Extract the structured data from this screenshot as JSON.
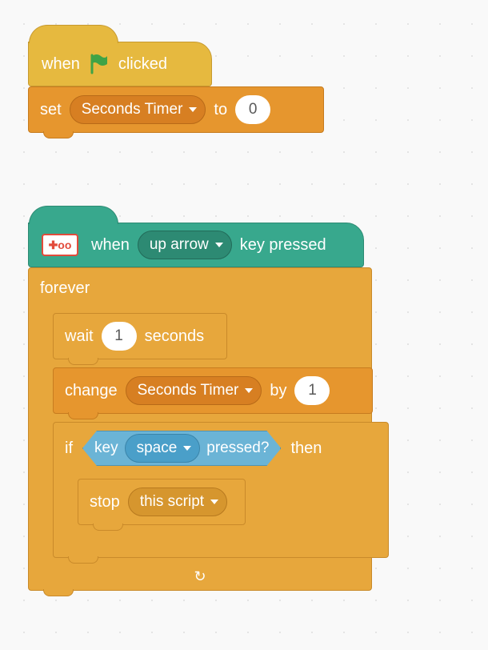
{
  "script1": {
    "hat_prefix": "when",
    "hat_suffix": "clicked",
    "set_label": "set",
    "var_name": "Seconds Timer",
    "to_label": "to",
    "value": "0"
  },
  "script2": {
    "hat_prefix": "when",
    "key": "up arrow",
    "hat_suffix": "key pressed",
    "badge": "✚oo",
    "forever_label": "forever",
    "wait_label": "wait",
    "wait_value": "1",
    "seconds_label": "seconds",
    "change_label": "change",
    "var_name": "Seconds Timer",
    "by_label": "by",
    "change_value": "1",
    "if_label": "if",
    "then_label": "then",
    "key_label": "key",
    "key_value": "space",
    "pressed_label": "pressed?",
    "stop_label": "stop",
    "stop_option": "this script"
  }
}
